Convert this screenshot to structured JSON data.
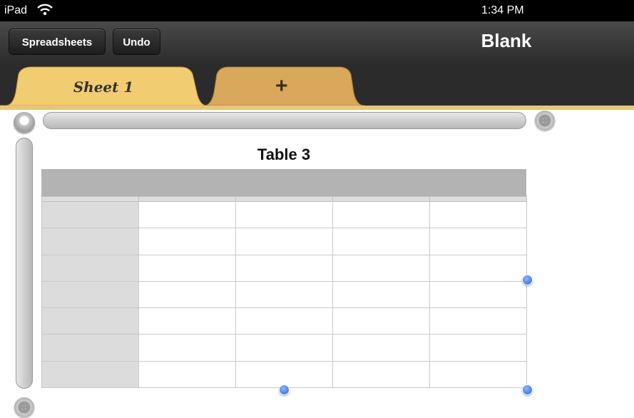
{
  "status_bar": {
    "carrier": "iPad",
    "time": "1:34 PM"
  },
  "toolbar": {
    "spreadsheets_label": "Spreadsheets",
    "undo_label": "Undo",
    "document_title": "Blank"
  },
  "tabs": {
    "sheet1_label": "Sheet 1",
    "add_label": "+"
  },
  "table": {
    "title": "Table 3",
    "columns": 5,
    "body_rows": 7
  },
  "colors": {
    "tab": "#f0c96b",
    "header_band": "#b3b3b3",
    "selection_dot": "#2a64d6"
  },
  "icons": [
    "wifi-icon",
    "column-select-icon",
    "column-handle-icon",
    "row-handle-icon"
  ]
}
